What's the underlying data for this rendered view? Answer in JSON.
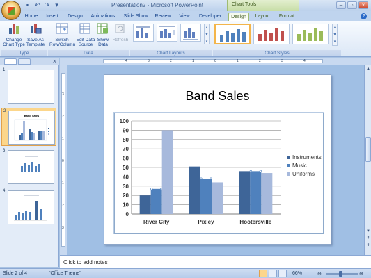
{
  "window": {
    "title": "Presentation2 - Microsoft PowerPoint",
    "context_tab_group": "Chart Tools"
  },
  "tabs": [
    {
      "label": "Home",
      "active": false
    },
    {
      "label": "Insert",
      "active": false
    },
    {
      "label": "Design",
      "active": false
    },
    {
      "label": "Animations",
      "active": false
    },
    {
      "label": "Slide Show",
      "active": false
    },
    {
      "label": "Review",
      "active": false
    },
    {
      "label": "View",
      "active": false
    },
    {
      "label": "Developer",
      "active": false
    },
    {
      "label": "Design",
      "active": true
    },
    {
      "label": "Layout",
      "active": false
    },
    {
      "label": "Format",
      "active": false
    }
  ],
  "ribbon": {
    "groups": {
      "type": "Type",
      "data": "Data",
      "chart_layouts": "Chart Layouts",
      "chart_styles": "Chart Styles"
    },
    "buttons": {
      "change_chart_type_1": "Change",
      "change_chart_type_2": "Chart Type",
      "save_template_1": "Save As",
      "save_template_2": "Template",
      "switch_row_col_1": "Switch",
      "switch_row_col_2": "Row/Column",
      "edit_data_source_1": "Edit Data",
      "edit_data_source_2": "Source",
      "show_data_1": "Show",
      "show_data_2": "Data",
      "refresh": "Refresh"
    }
  },
  "slides_pane": {
    "slides": [
      {
        "number": "1",
        "title": ""
      },
      {
        "number": "2",
        "title": "Band Sales"
      },
      {
        "number": "3",
        "title": ""
      },
      {
        "number": "4",
        "title": ""
      }
    ]
  },
  "ruler": {
    "h_labels": [
      "4",
      "3",
      "2",
      "1",
      "0",
      "1",
      "2",
      "3",
      "4"
    ],
    "v_labels": [
      "3",
      "2",
      "1",
      "0",
      "1",
      "2",
      "3"
    ]
  },
  "slide": {
    "title": "Band Sales"
  },
  "notes": {
    "placeholder": "Click to add notes"
  },
  "status": {
    "slide_info": "Slide 2 of 4",
    "theme": "\"Office Theme\"",
    "zoom": "66%"
  },
  "colors": {
    "instruments": "#3e6598",
    "music": "#4f81bd",
    "uniforms": "#a7b9dc"
  },
  "chart_data": {
    "type": "bar",
    "title": "",
    "categories": [
      "River City",
      "Pixley",
      "Hootersville"
    ],
    "series": [
      {
        "name": "Instruments",
        "values": [
          20,
          51,
          46
        ]
      },
      {
        "name": "Music",
        "values": [
          27,
          38,
          46
        ]
      },
      {
        "name": "Uniforms",
        "values": [
          90,
          34,
          44
        ]
      }
    ],
    "ylim": [
      0,
      100
    ],
    "yticks": [
      "0",
      "10",
      "20",
      "30",
      "40",
      "50",
      "60",
      "70",
      "80",
      "90",
      "100"
    ],
    "grid": true,
    "legend_position": "right"
  }
}
